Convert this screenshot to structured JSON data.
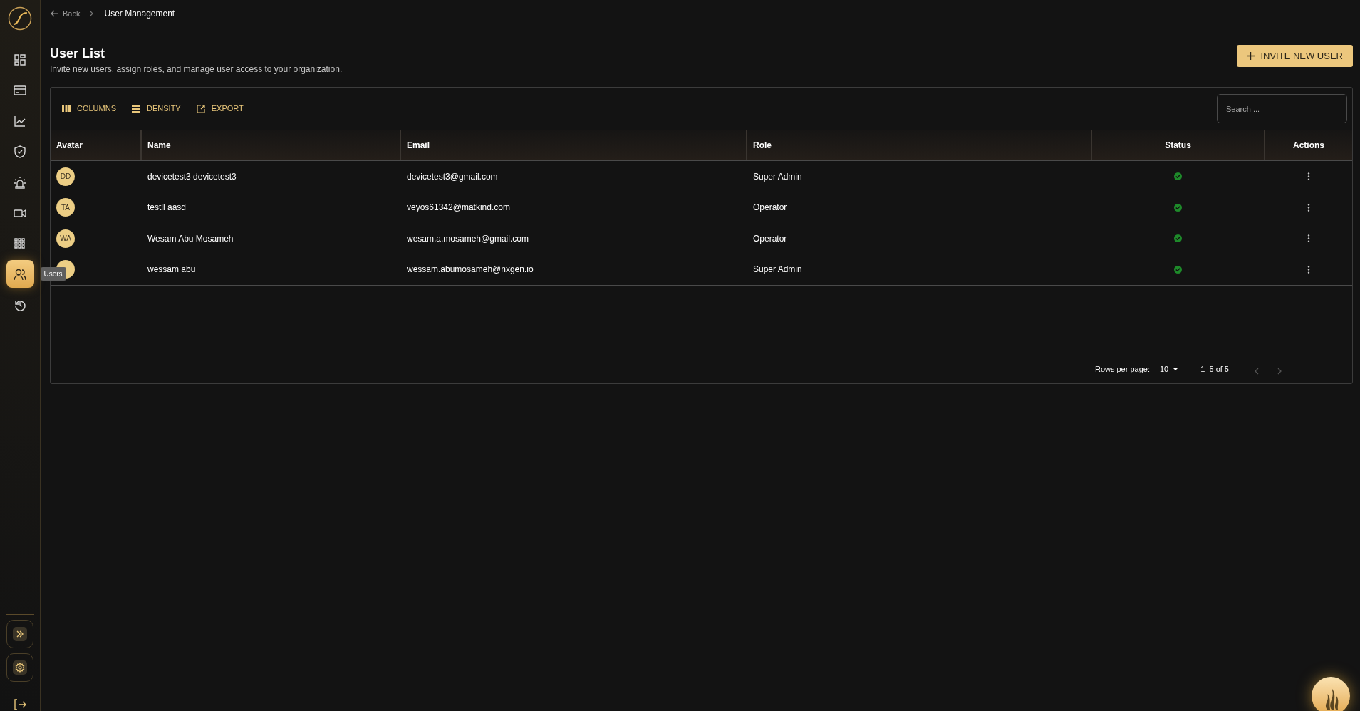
{
  "sidebar": {
    "items": [
      {
        "kind": "dashboard",
        "selected": false
      },
      {
        "kind": "card",
        "selected": false
      },
      {
        "kind": "chart",
        "selected": false
      },
      {
        "kind": "shield",
        "selected": false
      },
      {
        "kind": "alarm",
        "selected": false
      },
      {
        "kind": "video",
        "selected": false
      },
      {
        "kind": "grid",
        "selected": false
      },
      {
        "kind": "users",
        "selected": true,
        "tooltip": "Users"
      },
      {
        "kind": "history",
        "selected": false
      }
    ]
  },
  "breadcrumb": {
    "back": "Back",
    "current": "User Management"
  },
  "header": {
    "title": "User List",
    "subtitle": "Invite new users, assign roles, and manage user access to your organization.",
    "invite_button": "INVITE NEW USER"
  },
  "toolbar": {
    "buttons": [
      {
        "kind": "columns",
        "label": "COLUMNS"
      },
      {
        "kind": "density",
        "label": "DENSITY"
      },
      {
        "kind": "export",
        "label": "EXPORT"
      }
    ],
    "search": {
      "placeholder": "Search ..."
    }
  },
  "table": {
    "columns": [
      "Avatar",
      "Name",
      "Email",
      "Role",
      "Status",
      "Actions"
    ],
    "rows": [
      {
        "initials": "DD",
        "name": "devicetest3 devicetest3",
        "email": "devicetest3@gmail.com",
        "role": "Super Admin",
        "active": true
      },
      {
        "initials": "TA",
        "name": "testll aasd",
        "email": "veyos61342@matkind.com",
        "role": "Operator",
        "active": true
      },
      {
        "initials": "WA",
        "name": "Wesam Abu Mosameh",
        "email": "wesam.a.mosameh@gmail.com",
        "role": "Operator",
        "active": true
      },
      {
        "name": "wessam abu",
        "email": "wessam.abumosameh@nxgen.io",
        "role": "Super Admin",
        "active": true
      }
    ]
  },
  "pagination": {
    "rows_per_page_label": "Rows per page:",
    "rows_per_page": "10",
    "range": "1–5 of 5"
  }
}
